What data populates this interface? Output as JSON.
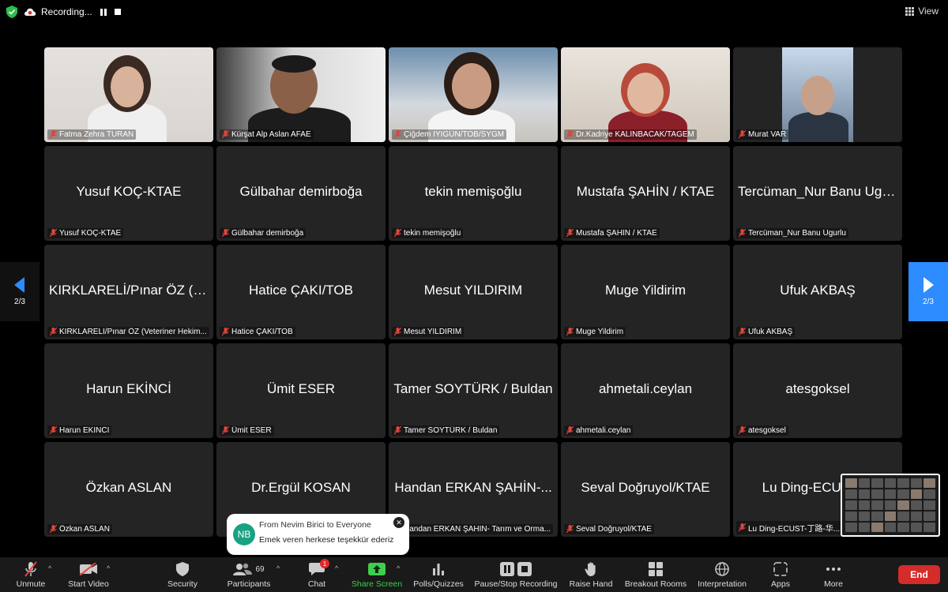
{
  "topbar": {
    "recording_label": "Recording...",
    "view_label": "View"
  },
  "pager": {
    "left_label": "2/3",
    "right_label": "2/3"
  },
  "video_tiles": [
    {
      "label": "Fatma Zehra TURAN"
    },
    {
      "label": "Kürşat Alp Aslan AFAE"
    },
    {
      "label": "Çiğdem İYİGÜN/TOB/SYGM"
    },
    {
      "label": "Dr.Kadriye KALINBACAK/TAGEM"
    },
    {
      "label": "Murat VAR"
    }
  ],
  "name_tiles": [
    {
      "name": "Yusuf KOÇ-KTAE",
      "label": "Yusuf KOÇ-KTAE"
    },
    {
      "name": "Gülbahar demirboğa",
      "label": "Gülbahar demirboğa"
    },
    {
      "name": "tekin memişoğlu",
      "label": "tekin memişoğlu"
    },
    {
      "name": "Mustafa ŞAHİN / KTAE",
      "label": "Mustafa ŞAHİN / KTAE"
    },
    {
      "name": "Tercüman_Nur Banu Ugu...",
      "label": "Tercüman_Nur Banu Ugurlu"
    },
    {
      "name": "KIRKLARELİ/Pınar ÖZ (V...",
      "label": "KIRKLARELİ/Pınar ÖZ (Veteriner Hekim..."
    },
    {
      "name": "Hatice ÇAKI/TOB",
      "label": "Hatice ÇAKI/TOB"
    },
    {
      "name": "Mesut YILDIRIM",
      "label": "Mesut YILDIRIM"
    },
    {
      "name": "Muge Yildirim",
      "label": "Muge Yildirim"
    },
    {
      "name": "Ufuk AKBAŞ",
      "label": "Ufuk AKBAŞ"
    },
    {
      "name": "Harun EKİNCİ",
      "label": "Harun EKİNCİ"
    },
    {
      "name": "Ümit ESER",
      "label": "Ümit ESER"
    },
    {
      "name": "Tamer SOYTÜRK / Buldan",
      "label": "Tamer SOYTÜRK / Buldan"
    },
    {
      "name": "ahmetali.ceylan",
      "label": "ahmetali.ceylan"
    },
    {
      "name": "atesgoksel",
      "label": "atesgoksel"
    },
    {
      "name": "Özkan ASLAN",
      "label": "Özkan ASLAN"
    },
    {
      "name": "Dr.Ergül KOSAN",
      "label": ""
    },
    {
      "name": "Handan ERKAN ŞAHİN-...",
      "label": "Handan ERKAN ŞAHİN- Tarım ve Orma..."
    },
    {
      "name": "Seval Doğruyol/KTAE",
      "label": "Seval Doğruyol/KTAE"
    },
    {
      "name": "Lu Ding-ECUST-...",
      "label": "Lu Ding-ECUST-丁路-华..."
    }
  ],
  "chat_toast": {
    "avatar_initials": "NB",
    "from": "From Nevim Birici to Everyone",
    "message": "Emek veren herkese teşekkür ederiz",
    "close_label": "✕"
  },
  "toolbar": {
    "unmute": "Unmute",
    "start_video": "Start Video",
    "security": "Security",
    "participants": "Participants",
    "participants_count": "69",
    "chat": "Chat",
    "chat_badge": "1",
    "share_screen": "Share Screen",
    "polls": "Polls/Quizzes",
    "pause_recording": "Pause/Stop Recording",
    "raise_hand": "Raise Hand",
    "breakout": "Breakout Rooms",
    "interpretation": "Interpretation",
    "apps": "Apps",
    "more": "More",
    "end": "End"
  },
  "colors": {
    "accent": "#2d8cff",
    "share_green": "#3ecf4c",
    "end_red": "#d42b2b",
    "tile_bg": "#242424"
  }
}
